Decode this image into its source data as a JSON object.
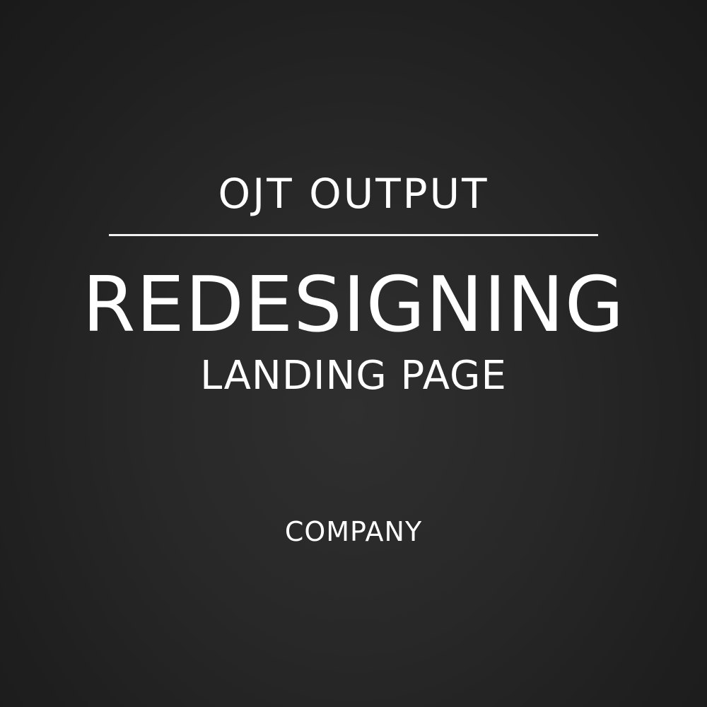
{
  "cover": {
    "eyebrow": "OJT OUTPUT",
    "headline": "REDESIGNING",
    "subhead": "LANDING PAGE",
    "company": "COMPANY"
  },
  "colors": {
    "background": "#2a2a2a",
    "text": "#ffffff",
    "rule": "#f2f2f2"
  }
}
